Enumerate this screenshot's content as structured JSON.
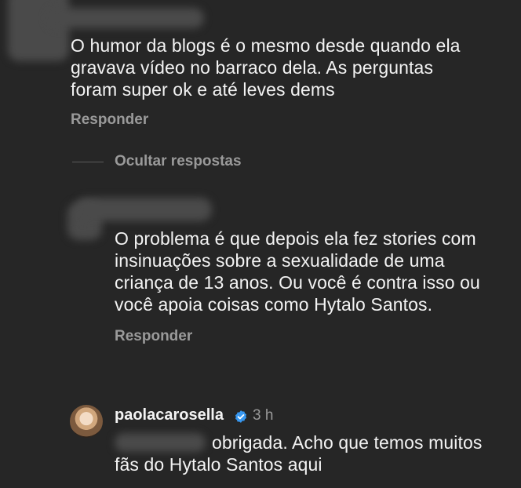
{
  "comments": [
    {
      "text_lines": [
        "O humor da blogs é o mesmo desde quando ela",
        "gravava vídeo no barraco dela. As perguntas",
        "foram super ok e até leves dems"
      ],
      "reply_label": "Responder"
    },
    {
      "hide_replies_label": "Ocultar respostas",
      "text_lines": [
        "O problema é que depois ela fez stories com",
        "insinuações sobre a sexualidade de uma",
        "criança de 13 anos. Ou você é contra isso ou",
        "você apoia coisas como Hytalo Santos."
      ],
      "reply_label": "Responder"
    },
    {
      "username": "paolacarosella",
      "verified": true,
      "timestamp": "3 h",
      "text_lines": [
        "obrigada. Acho que temos muitos",
        "fãs do Hytalo Santos aqui"
      ]
    }
  ],
  "colors": {
    "background": "#262626",
    "text": "#f3f3f3",
    "muted": "#9a9a9a",
    "verified": "#3797f0"
  }
}
